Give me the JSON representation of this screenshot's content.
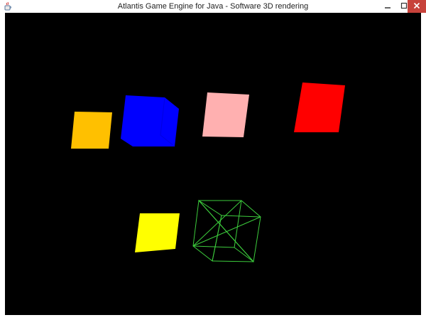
{
  "window": {
    "title": "Atlantis Game Engine for Java - Software 3D rendering",
    "icons": {
      "app": "java-cup-icon",
      "minimize": "minimize-icon",
      "maximize": "maximize-icon",
      "close": "close-icon"
    }
  },
  "scene": {
    "background": "#000000",
    "objects": [
      {
        "name": "orange-quad",
        "color": "#ffc000",
        "style": "filled"
      },
      {
        "name": "blue-cube",
        "color": "#0000ff",
        "style": "filled"
      },
      {
        "name": "pink-quad",
        "color": "#ffb0b0",
        "style": "filled"
      },
      {
        "name": "red-quad",
        "color": "#ff0000",
        "style": "filled"
      },
      {
        "name": "yellow-quad",
        "color": "#ffff00",
        "style": "filled"
      },
      {
        "name": "green-wireframe-cube",
        "color": "#3ccc3c",
        "style": "wireframe"
      }
    ]
  }
}
